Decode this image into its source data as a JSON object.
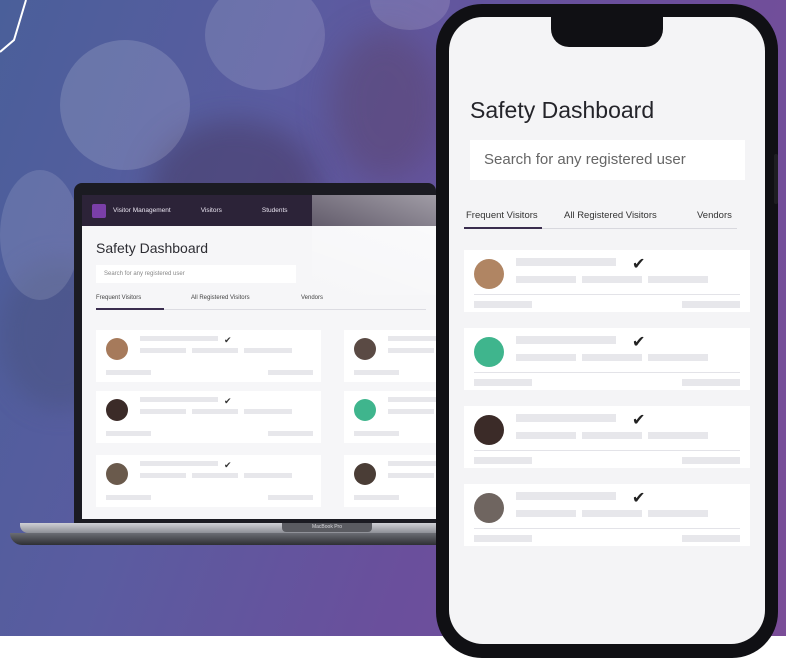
{
  "colors": {
    "accent": "#3a2d4e",
    "nav_bg": "#2c2338",
    "logo": "#7a3fa8"
  },
  "laptop": {
    "nav": {
      "app": "Visitor Management",
      "item1": "Visitors",
      "item2": "Students"
    },
    "title": "Safety Dashboard",
    "search_placeholder": "Search for any registered user",
    "tabs": [
      "Frequent Visitors",
      "All Registered Visitors",
      "Vendors"
    ],
    "brand_label": "MacBook Pro"
  },
  "phone": {
    "title": "Safety Dashboard",
    "search_placeholder": "Search for any registered user",
    "tabs": [
      "Frequent Visitors",
      "All Registered Visitors",
      "Vendors"
    ],
    "verified_mark": "✔"
  }
}
